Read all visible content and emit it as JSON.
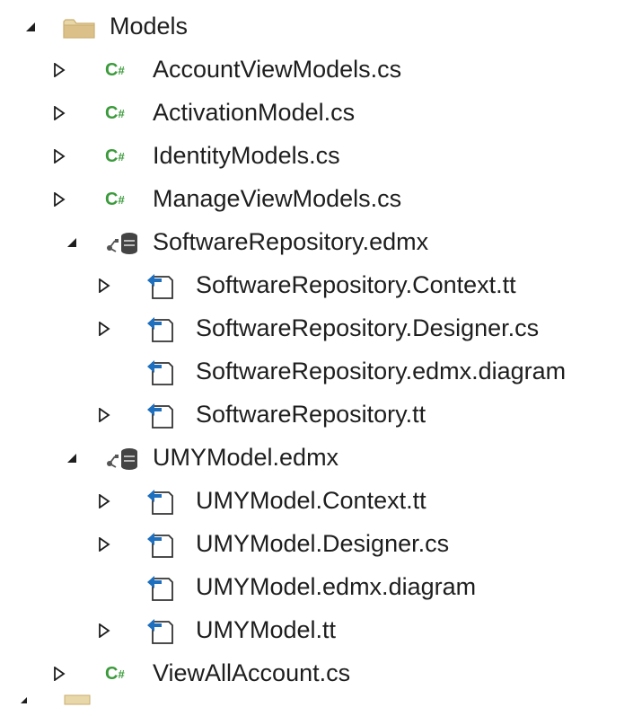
{
  "tree": {
    "folder": {
      "label": "Models",
      "icon": "folder-icon",
      "expanded": true
    },
    "items": [
      {
        "label": "AccountViewModels.cs",
        "icon": "csharp-file-icon",
        "expander": "collapsed"
      },
      {
        "label": "ActivationModel.cs",
        "icon": "csharp-file-icon",
        "expander": "collapsed"
      },
      {
        "label": "IdentityModels.cs",
        "icon": "csharp-file-icon",
        "expander": "collapsed"
      },
      {
        "label": "ManageViewModels.cs",
        "icon": "csharp-file-icon",
        "expander": "collapsed"
      },
      {
        "label": "SoftwareRepository.edmx",
        "icon": "edmx-file-icon",
        "expander": "expanded",
        "children": [
          {
            "label": "SoftwareRepository.Context.tt",
            "icon": "template-file-icon",
            "expander": "collapsed"
          },
          {
            "label": "SoftwareRepository.Designer.cs",
            "icon": "template-file-icon",
            "expander": "collapsed"
          },
          {
            "label": "SoftwareRepository.edmx.diagram",
            "icon": "template-file-icon",
            "expander": "none"
          },
          {
            "label": "SoftwareRepository.tt",
            "icon": "template-file-icon",
            "expander": "collapsed"
          }
        ]
      },
      {
        "label": "UMYModel.edmx",
        "icon": "edmx-file-icon",
        "expander": "expanded",
        "children": [
          {
            "label": "UMYModel.Context.tt",
            "icon": "template-file-icon",
            "expander": "collapsed"
          },
          {
            "label": "UMYModel.Designer.cs",
            "icon": "template-file-icon",
            "expander": "collapsed"
          },
          {
            "label": "UMYModel.edmx.diagram",
            "icon": "template-file-icon",
            "expander": "none"
          },
          {
            "label": "UMYModel.tt",
            "icon": "template-file-icon",
            "expander": "collapsed"
          }
        ]
      },
      {
        "label": "ViewAllAccount.cs",
        "icon": "csharp-file-icon",
        "expander": "collapsed"
      }
    ],
    "cs_glyph": "C",
    "cs_glyph_sup": "#"
  },
  "colors": {
    "text": "#1e1e1e",
    "csharp_green": "#3b9a3b",
    "template_blue": "#1f6fbf",
    "folder_tan": "#dcb67a",
    "arrow": "#1e1e1e"
  }
}
